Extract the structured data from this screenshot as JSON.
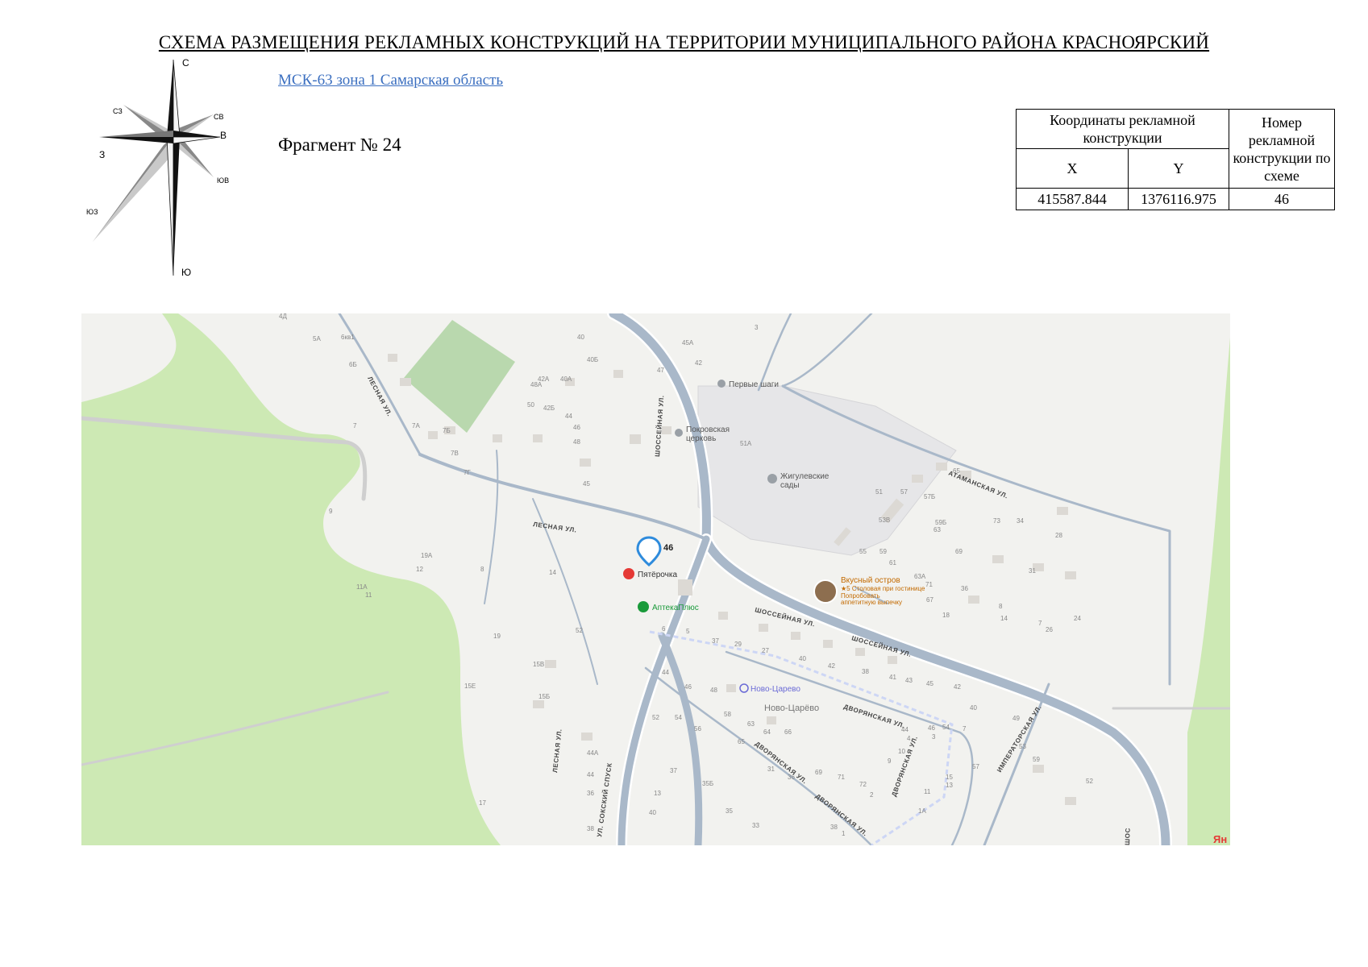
{
  "header": {
    "title": "СХЕМА РАЗМЕЩЕНИЯ РЕКЛАМНЫХ КОНСТРУКЦИЙ НА ТЕРРИТОРИИ МУНИЦИПАЛЬНОГО РАЙОНА КРАСНОЯРСКИЙ",
    "coordinate_system": "МСК-63 зона 1 Самарская область",
    "fragment": "Фрагмент № 24"
  },
  "compass": {
    "n": "С",
    "s": "Ю",
    "e": "В",
    "w": "З",
    "ne": "СВ",
    "nw": "СЗ",
    "se": "ЮВ",
    "sw": "ЮЗ"
  },
  "table": {
    "col_coords": "Координаты рекламной конструкции",
    "col_number": "Номер рекламной конструкции по схеме",
    "x_header": "X",
    "y_header": "Y",
    "x": "415587.844",
    "y": "1376116.975",
    "number": "46"
  },
  "map": {
    "marker_label": "46",
    "streets": {
      "shosseynaya_vertical": "ШОССЕЙНАЯ УЛ.",
      "shosseynaya_1": "ШОССЕЙНАЯ УЛ.",
      "shosseynaya_2": "ШОССЕЙНАЯ УЛ.",
      "lesnaya_1": "ЛЕСНАЯ УЛ.",
      "lesnaya_2": "ЛЕСНАЯ УЛ.",
      "lesnaya_3": "ЛЕСНАЯ УЛ.",
      "atamanskaya": "АТАМАНСКАЯ УЛ.",
      "dvoryanskaya_1": "ДВОРЯНСКАЯ УЛ.",
      "dvoryanskaya_2": "ДВОРЯНСКАЯ УЛ.",
      "dvoryanskaya_3": "ДВОРЯНСКАЯ УЛ.",
      "dvoryanskaya_4": "ДВОРЯНСКАЯ УЛ.",
      "imperatorskaya": "ИМПЕРАТОРСКАЯ УЛ.",
      "sokskiy": "УЛ. СОКСКИЙ СПУСК",
      "shos_edge": "ШОС"
    },
    "pois": {
      "first_steps": "Первые шаги",
      "church_1": "Покровская",
      "church_2": "церковь",
      "gardens_1": "Жигулевские",
      "gardens_2": "сады",
      "pyaterochka": "Пятёрочка",
      "apteka": "АптекаПлюс",
      "cafe_name": "Вкусный остров",
      "cafe_line1": "★5 Столовая при гостинице",
      "cafe_line2": "Попробовать",
      "cafe_line3": "аппетитную выпечку",
      "bus_stop": "Ново-Царево",
      "district": "Ново-Царёво"
    },
    "house_numbers": [
      "4Д",
      "5А",
      "6кв1",
      "6Б",
      "7",
      "7А",
      "7Б",
      "7В",
      "7Г",
      "9",
      "11",
      "11А",
      "12",
      "14",
      "15Б",
      "15В",
      "15Е",
      "17",
      "19",
      "19А",
      "8",
      "52",
      "40",
      "40Б",
      "40А",
      "42А",
      "42Б",
      "44",
      "46",
      "48",
      "48А",
      "50",
      "45",
      "45А",
      "47",
      "42",
      "3",
      "51А",
      "51",
      "53В",
      "55",
      "57",
      "57Б",
      "59",
      "59Б",
      "61",
      "63",
      "63А",
      "65",
      "67",
      "69",
      "71",
      "73",
      "36",
      "34",
      "31",
      "28",
      "26",
      "24",
      "18",
      "14",
      "8",
      "7",
      "6",
      "5",
      "37",
      "29",
      "27",
      "40",
      "42",
      "38",
      "41",
      "43",
      "45",
      "44",
      "46",
      "48",
      "52",
      "54",
      "56",
      "58",
      "65",
      "63",
      "64",
      "66",
      "69",
      "71",
      "72",
      "2",
      "1А",
      "11",
      "13",
      "15",
      "9",
      "10",
      "4",
      "3",
      "7",
      "40",
      "42",
      "44",
      "46",
      "54",
      "57",
      "49",
      "53",
      "59",
      "37",
      "35Б",
      "35",
      "33",
      "31",
      "36",
      "38",
      "1",
      "44А",
      "44",
      "36",
      "38",
      "40",
      "13",
      "52"
    ],
    "brand": "Ян"
  },
  "colors": {
    "map_background": "#f2f2ef",
    "forest": "#cde9b4",
    "field": "#b9d8ae",
    "road": "#a9b8c9",
    "road_casing": "#ffffff",
    "area_gray": "#e6e6e8",
    "building": "#dcd9d4",
    "street_label": "#444444",
    "house_label": "#888888",
    "marker": "#2e8bdc",
    "bus_stop": "#6b6bd6",
    "cafe": "#c36a00",
    "pharmacy": "#1a9a3a",
    "store": "#e53935",
    "link": "#3b6fc0"
  }
}
